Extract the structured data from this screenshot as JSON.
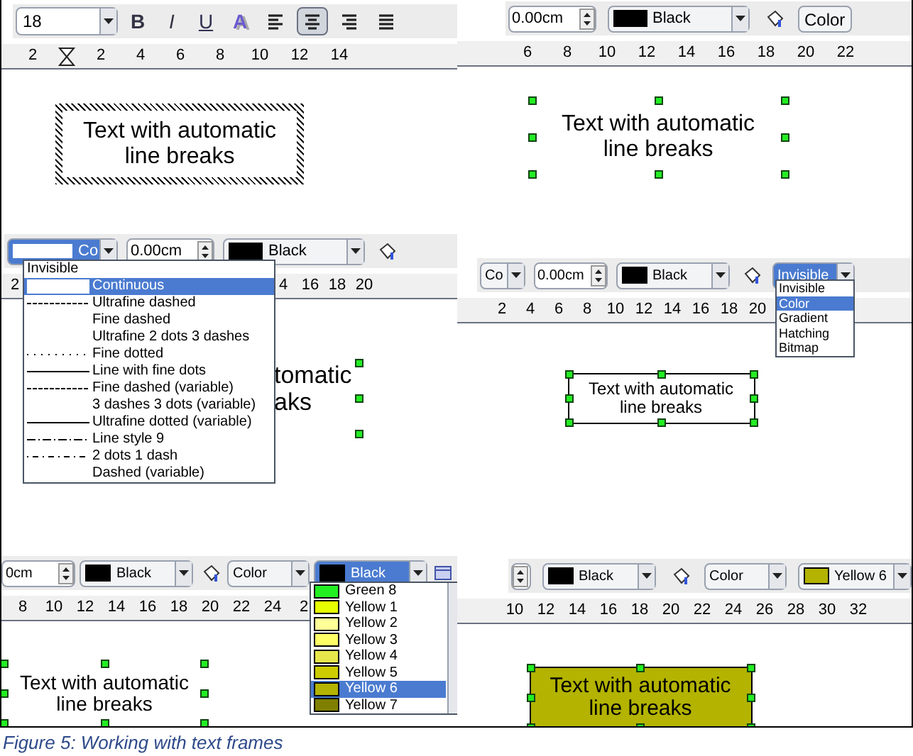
{
  "panels": [
    {
      "toolbar": [
        {
          "kind": "size-combo",
          "label": "18"
        },
        {
          "kind": "bold-button",
          "label": "B"
        },
        {
          "kind": "italic-button",
          "label": "I"
        },
        {
          "kind": "underline-button",
          "label": "U"
        },
        {
          "kind": "shadow-button",
          "label": "A"
        },
        {
          "kind": "align-left-button",
          "selected": false
        },
        {
          "kind": "align-center-button",
          "selected": true
        },
        {
          "kind": "align-right-button",
          "selected": false
        },
        {
          "kind": "justify-button",
          "selected": false
        }
      ],
      "ruler": [
        "2",
        "2",
        "4",
        "6",
        "8",
        "10",
        "12",
        "14"
      ],
      "indent_marker": true,
      "frame": {
        "kind": "hatched",
        "text": "Text with automatic line breaks"
      }
    },
    {
      "toolbar": [
        {
          "kind": "spin",
          "label": "0.00cm"
        },
        {
          "kind": "color-combo",
          "label": "Black",
          "color": "#000000",
          "active": false
        },
        {
          "kind": "fill-button"
        },
        {
          "kind": "text-button",
          "label": "Color"
        }
      ],
      "ruler": [
        "6",
        "8",
        "10",
        "12",
        "14",
        "16",
        "18",
        "20",
        "22"
      ],
      "frame": {
        "kind": "handles",
        "text": "Text with automatic line breaks"
      }
    },
    {
      "toolbar": [
        {
          "kind": "style-combo",
          "label": "Co",
          "active": true
        },
        {
          "kind": "spin",
          "label": "0.00cm"
        },
        {
          "kind": "color-combo",
          "label": "Black",
          "color": "#000000",
          "active": false
        },
        {
          "kind": "fill-button"
        }
      ],
      "ruler": [
        "2",
        "4",
        "16",
        "18",
        "20"
      ],
      "dropdown": {
        "kind": "line-list",
        "items": [
          {
            "label": "Invisible",
            "kind": "plain",
            "selected": false
          },
          {
            "label": "Continuous",
            "kind": "solid",
            "selected": true
          },
          {
            "label": "Ultrafine dashed",
            "kind": "dashed",
            "selected": false
          },
          {
            "label": "Fine dashed",
            "kind": "blank",
            "selected": false
          },
          {
            "label": "Ultrafine 2 dots 3 dashes",
            "kind": "blank",
            "selected": false
          },
          {
            "label": "Fine dotted",
            "kind": "dotted",
            "selected": false
          },
          {
            "label": "Line with fine dots",
            "kind": "solid",
            "selected": false
          },
          {
            "label": "Fine dashed (variable)",
            "kind": "dashed",
            "selected": false
          },
          {
            "label": "3 dashes 3 dots (variable)",
            "kind": "blank",
            "selected": false
          },
          {
            "label": "Ultrafine dotted (variable)",
            "kind": "solid",
            "selected": false
          },
          {
            "label": "Line style 9",
            "kind": "dashdot",
            "selected": false
          },
          {
            "label": "2 dots 1 dash",
            "kind": "dotdash",
            "selected": false
          },
          {
            "label": "Dashed (variable)",
            "kind": "blank",
            "selected": false
          }
        ]
      },
      "frame": {
        "kind": "fragments",
        "lines": [
          "tomatic",
          "aks"
        ]
      }
    },
    {
      "toolbar": [
        {
          "kind": "style-combo",
          "label": "Co",
          "active": false
        },
        {
          "kind": "spin",
          "label": "0.00cm"
        },
        {
          "kind": "color-combo",
          "label": "Black",
          "color": "#000000",
          "active": false
        },
        {
          "kind": "fill-button"
        },
        {
          "kind": "area-combo",
          "label": "Invisible",
          "active": true
        }
      ],
      "ruler": [
        "2",
        "4",
        "6",
        "8",
        "10",
        "12",
        "14",
        "16",
        "18",
        "20"
      ],
      "dropdown": {
        "kind": "area-list",
        "items": [
          {
            "label": "Invisible",
            "selected": false
          },
          {
            "label": "Color",
            "selected": true
          },
          {
            "label": "Gradient",
            "selected": false
          },
          {
            "label": "Hatching",
            "selected": false
          },
          {
            "label": "Bitmap",
            "selected": false
          }
        ]
      },
      "frame": {
        "kind": "bordered",
        "text": "Text with automatic line breaks"
      }
    },
    {
      "toolbar": [
        {
          "kind": "spin",
          "label": "0cm"
        },
        {
          "kind": "color-combo",
          "label": "Black",
          "color": "#000000",
          "active": false
        },
        {
          "kind": "fill-button"
        },
        {
          "kind": "area-combo",
          "label": "Color",
          "active": false
        },
        {
          "kind": "color-combo",
          "label": "Black",
          "color": "#000000",
          "active": true
        },
        {
          "kind": "object-button"
        }
      ],
      "ruler": [
        "8",
        "10",
        "12",
        "14",
        "16",
        "18",
        "20",
        "22",
        "24",
        "2"
      ],
      "dropdown": {
        "kind": "color-list",
        "items": [
          {
            "label": "Green 8",
            "color": "#22ee22",
            "selected": false
          },
          {
            "label": "Yellow 1",
            "color": "#e6ff00",
            "selected": false
          },
          {
            "label": "Yellow 2",
            "color": "#ffff99",
            "selected": false
          },
          {
            "label": "Yellow 3",
            "color": "#ffff66",
            "selected": false
          },
          {
            "label": "Yellow 4",
            "color": "#e6e64c",
            "selected": false
          },
          {
            "label": "Yellow 5",
            "color": "#cccc00",
            "selected": false
          },
          {
            "label": "Yellow 6",
            "color": "#b3b300",
            "selected": true
          },
          {
            "label": "Yellow 7",
            "color": "#808000",
            "selected": false
          }
        ]
      },
      "frame": {
        "kind": "handles",
        "text": "Text with automatic line breaks"
      }
    },
    {
      "toolbar": [
        {
          "kind": "spin"
        },
        {
          "kind": "color-combo",
          "label": "Black",
          "color": "#000000",
          "active": false
        },
        {
          "kind": "fill-button"
        },
        {
          "kind": "area-combo",
          "label": "Color",
          "active": false
        },
        {
          "kind": "color-combo",
          "label": "Yellow 6",
          "color": "#b3b300",
          "active": false
        }
      ],
      "ruler": [
        "10",
        "12",
        "14",
        "16",
        "18",
        "20",
        "22",
        "24",
        "26",
        "28",
        "30",
        "32"
      ],
      "frame": {
        "kind": "filled",
        "color": "#b3b300",
        "text": "Text with automatic line breaks"
      }
    }
  ],
  "caption": "Figure 5: Working with text frames"
}
